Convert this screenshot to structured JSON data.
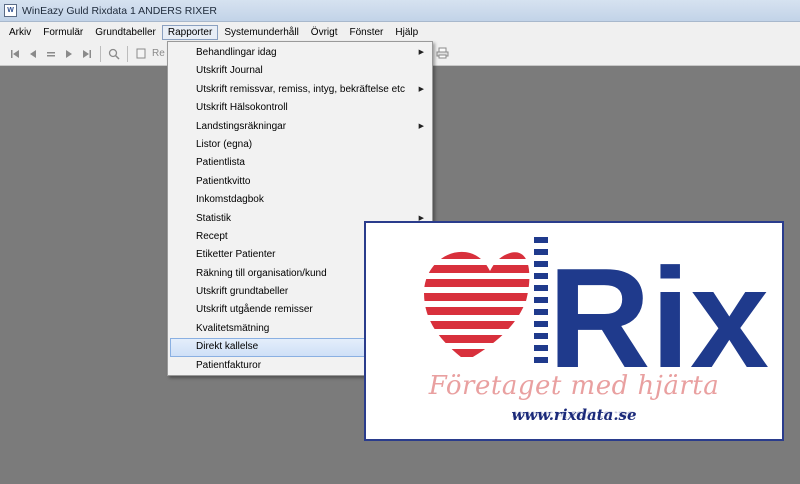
{
  "window": {
    "title": "WinEazy Guld Rixdata 1 ANDERS RIXER",
    "icon": "app-icon"
  },
  "menubar": {
    "items": [
      "Arkiv",
      "Formulär",
      "Grundtabeller",
      "Rapporter",
      "Systemunderhåll",
      "Övrigt",
      "Fönster",
      "Hjälp"
    ],
    "active": "Rapporter"
  },
  "toolbar": {
    "label": "Re",
    "icons": [
      "first-record-icon",
      "previous-record-icon",
      "equals-icon",
      "next-record-icon",
      "last-record-icon",
      "search-icon",
      "print-icon"
    ]
  },
  "dropdown": {
    "items": [
      {
        "label": "Behandlingar idag",
        "submenu": true
      },
      {
        "label": "Utskrift Journal",
        "submenu": false
      },
      {
        "label": "Utskrift remissvar, remiss, intyg, bekräftelse etc",
        "submenu": true
      },
      {
        "label": "Utskrift Hälsokontroll",
        "submenu": false
      },
      {
        "label": "Landstingsräkningar",
        "submenu": true
      },
      {
        "label": "Listor (egna)",
        "submenu": false
      },
      {
        "label": "Patientlista",
        "submenu": false
      },
      {
        "label": "Patientkvitto",
        "submenu": false
      },
      {
        "label": "Inkomstdagbok",
        "submenu": false
      },
      {
        "label": "Statistik",
        "submenu": true
      },
      {
        "label": "Recept",
        "submenu": true
      },
      {
        "label": "Etiketter Patienter",
        "submenu": false
      },
      {
        "label": "Räkning till organisation/kund",
        "submenu": false
      },
      {
        "label": "Utskrift grundtabeller",
        "submenu": true
      },
      {
        "label": "Utskrift utgående remisser",
        "submenu": false
      },
      {
        "label": "Kvalitetsmätning",
        "submenu": true
      },
      {
        "label": "Direkt kallelse",
        "submenu": false,
        "highlighted": true
      },
      {
        "label": "Patientfakturor",
        "submenu": false
      }
    ]
  },
  "banner": {
    "logo_text": "Rix",
    "tagline": "Företaget med hjärta",
    "url": "www.rixdata.se",
    "colors": {
      "heart": "#d8303c",
      "logo": "#1f3a8c",
      "tagline": "#e9a0a0"
    }
  }
}
